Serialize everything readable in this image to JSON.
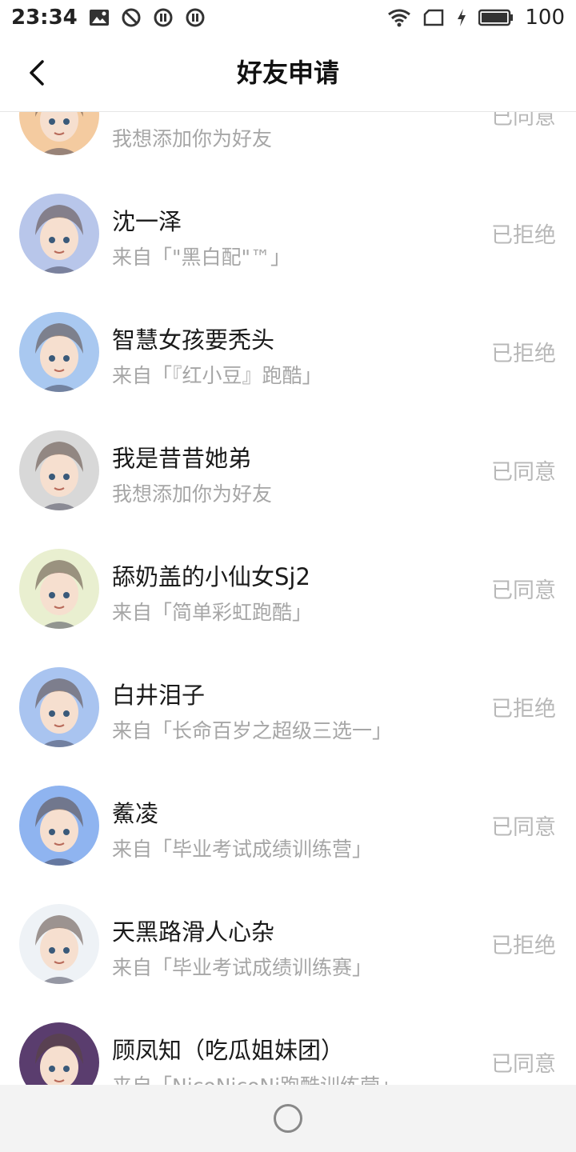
{
  "status_bar": {
    "time": "23:34",
    "battery": "100",
    "icons_left": [
      "image-icon",
      "do-not-disturb-icon",
      "pause-circle-icon",
      "pause-circle-icon"
    ],
    "icons_right": [
      "wifi-icon",
      "sim-icon",
      "charging-icon",
      "battery-icon"
    ]
  },
  "header": {
    "title": "好友申请"
  },
  "requests": [
    {
      "name": "",
      "source": "我想添加你为好友",
      "status": "已同意",
      "avatar_color": "#f4cba0"
    },
    {
      "name": "沈一泽",
      "source": "来自「\"黑白配\"™」",
      "status": "已拒绝",
      "avatar_color": "#b8c6ea"
    },
    {
      "name": "智慧女孩要秃头",
      "source": "来自「『红小豆』跑酷」",
      "status": "已拒绝",
      "avatar_color": "#a9c8f0"
    },
    {
      "name": "我是昔昔她弟",
      "source": "我想添加你为好友",
      "status": "已同意",
      "avatar_color": "#d8d8d8"
    },
    {
      "name": "舔奶盖的小仙女Sj2",
      "source": "来自「简单彩虹跑酷」",
      "status": "已同意",
      "avatar_color": "#e9efd0"
    },
    {
      "name": "白井泪子",
      "source": "来自「长命百岁之超级三选一」",
      "status": "已拒绝",
      "avatar_color": "#a9c4f0"
    },
    {
      "name": "鮺凌",
      "source": "来自「毕业考试成绩训练营」",
      "status": "已同意",
      "avatar_color": "#8fb4f0"
    },
    {
      "name": "天黑路滑人心杂",
      "source": "来自「毕业考试成绩训练赛」",
      "status": "已拒绝",
      "avatar_color": "#eef2f6"
    },
    {
      "name": "顾凤知（吃瓜姐妹团）",
      "source": "来自「NicoNicoNi跑酷训练营」",
      "status": "已同意",
      "avatar_color": "#5a3d6e"
    }
  ]
}
